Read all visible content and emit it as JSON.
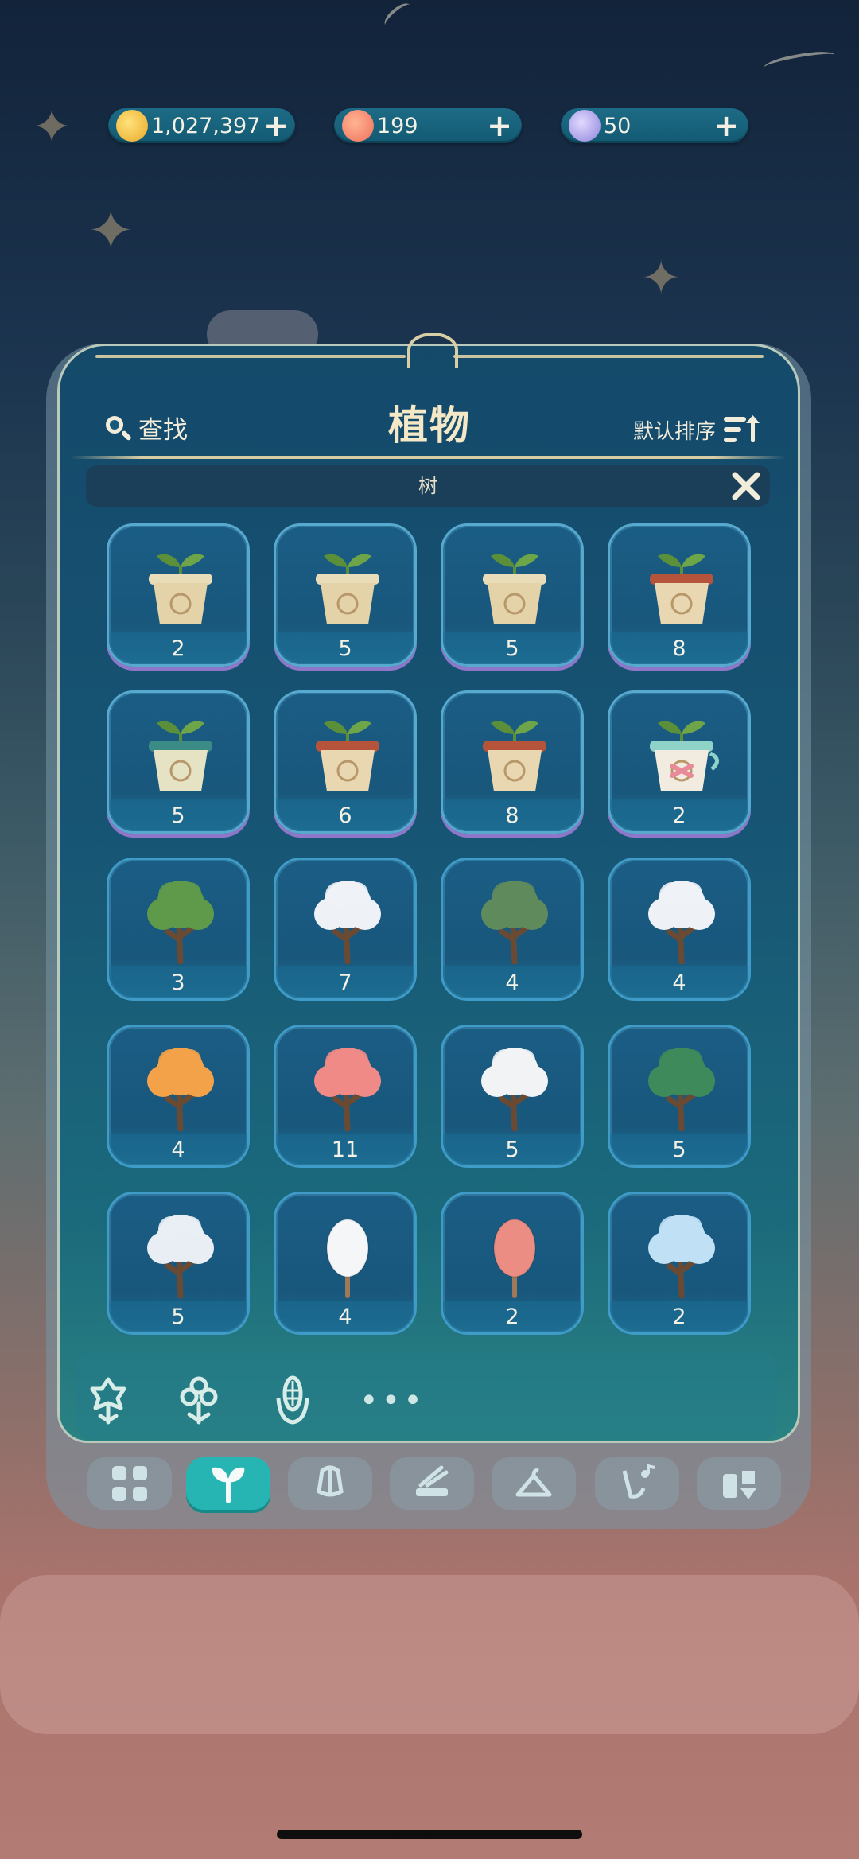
{
  "currencies": [
    {
      "icon": "gold-coin-icon",
      "value": "1,027,397"
    },
    {
      "icon": "flower-token-icon",
      "value": "199"
    },
    {
      "icon": "moon-token-icon",
      "value": "50"
    }
  ],
  "panel": {
    "search_label": "查找",
    "title": "植物",
    "sort_label": "默认排序",
    "filter_label": "树"
  },
  "items": [
    {
      "kind": "seed-pot",
      "pot": "beige",
      "count": "2"
    },
    {
      "kind": "seed-pot",
      "pot": "beige",
      "count": "5"
    },
    {
      "kind": "seed-pot",
      "pot": "beige",
      "count": "5"
    },
    {
      "kind": "seed-pot",
      "pot": "terracotta",
      "count": "8"
    },
    {
      "kind": "seed-pot",
      "pot": "teal",
      "count": "5"
    },
    {
      "kind": "seed-pot",
      "pot": "terracotta",
      "count": "6"
    },
    {
      "kind": "seed-pot",
      "pot": "terracotta",
      "count": "8"
    },
    {
      "kind": "seed-pot",
      "pot": "pink-cup",
      "count": "2"
    },
    {
      "kind": "tree",
      "color": "#5f9a4b",
      "count": "3"
    },
    {
      "kind": "tree",
      "color": "#eef2f6",
      "count": "7"
    },
    {
      "kind": "tree",
      "color": "#5f8a5c",
      "count": "4"
    },
    {
      "kind": "tree",
      "color": "#eef2f6",
      "count": "4"
    },
    {
      "kind": "tree",
      "color": "#f3a24a",
      "count": "4"
    },
    {
      "kind": "tree",
      "color": "#f08a86",
      "count": "11"
    },
    {
      "kind": "tree",
      "color": "#f1f3f5",
      "count": "5"
    },
    {
      "kind": "tree",
      "color": "#3f8a5a",
      "count": "5"
    },
    {
      "kind": "tree",
      "color": "#e9eef5",
      "count": "5"
    },
    {
      "kind": "egg-tree",
      "color": "#f4f6f8",
      "count": "4"
    },
    {
      "kind": "egg-tree",
      "color": "#ec8d84",
      "count": "2"
    },
    {
      "kind": "tree",
      "color": "#bfe0f5",
      "count": "2"
    }
  ],
  "categories": [
    "flower-icon",
    "blossom-icon",
    "corn-icon",
    "more-icon"
  ],
  "tabs": [
    {
      "icon": "grid-icon",
      "active": false
    },
    {
      "icon": "sprout-icon",
      "active": true
    },
    {
      "icon": "lantern-icon",
      "active": false
    },
    {
      "icon": "tools-icon",
      "active": false
    },
    {
      "icon": "hanger-icon",
      "active": false
    },
    {
      "icon": "music-icon",
      "active": false
    },
    {
      "icon": "puzzle-icon",
      "active": false
    }
  ],
  "colors": {
    "panel": "#175574",
    "cell_border": "#3f9cc8",
    "active_tab": "#27b5b3",
    "title": "#f4e8c6"
  }
}
